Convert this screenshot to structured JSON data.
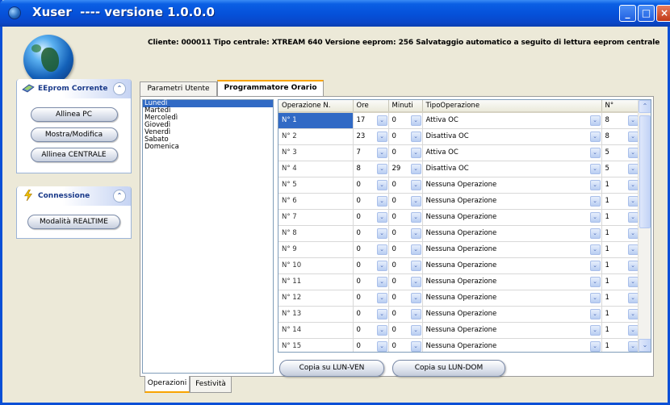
{
  "window": {
    "title": "Xuser  ---- versione 1.0.0.0",
    "controls": {
      "minimize": "_",
      "maximize": "□",
      "close": "×"
    }
  },
  "info_line": "Cliente: 000011 Tipo centrale: XTREAM 640 Versione eeprom: 256   Salvataggio automatico a seguito di lettura eeprom centrale",
  "sidebar": {
    "eeprom_panel": {
      "title": "EEprom Corrente",
      "icon": "eeprom-icon",
      "buttons": [
        "Allinea PC",
        "Mostra/Modifica",
        "Allinea CENTRALE"
      ]
    },
    "connection_panel": {
      "title": "Connessione",
      "icon": "lightning-icon",
      "buttons": [
        "Modalità REALTIME"
      ]
    }
  },
  "tabs_top": [
    "Parametri Utente",
    "Programmatore Orario"
  ],
  "active_top_tab": "Programmatore Orario",
  "days": [
    "Lunedì",
    "Martedì",
    "Mercoledì",
    "Giovedì",
    "Venerdì",
    "Sabato",
    "Domenica"
  ],
  "selected_day": "Lunedì",
  "grid": {
    "headers": [
      "Operazione N.",
      "Ore",
      "Minuti",
      "TipoOperazione",
      "N°"
    ],
    "rows": [
      {
        "op": "N° 1",
        "ore": "17",
        "min": "0",
        "tipo": "Attiva OC",
        "n": "8"
      },
      {
        "op": "N° 2",
        "ore": "23",
        "min": "0",
        "tipo": "Disattiva OC",
        "n": "8"
      },
      {
        "op": "N° 3",
        "ore": "7",
        "min": "0",
        "tipo": "Attiva OC",
        "n": "5"
      },
      {
        "op": "N° 4",
        "ore": "8",
        "min": "29",
        "tipo": "Disattiva OC",
        "n": "5"
      },
      {
        "op": "N° 5",
        "ore": "0",
        "min": "0",
        "tipo": "Nessuna Operazione",
        "n": "1"
      },
      {
        "op": "N° 6",
        "ore": "0",
        "min": "0",
        "tipo": "Nessuna Operazione",
        "n": "1"
      },
      {
        "op": "N° 7",
        "ore": "0",
        "min": "0",
        "tipo": "Nessuna Operazione",
        "n": "1"
      },
      {
        "op": "N° 8",
        "ore": "0",
        "min": "0",
        "tipo": "Nessuna Operazione",
        "n": "1"
      },
      {
        "op": "N° 9",
        "ore": "0",
        "min": "0",
        "tipo": "Nessuna Operazione",
        "n": "1"
      },
      {
        "op": "N° 10",
        "ore": "0",
        "min": "0",
        "tipo": "Nessuna Operazione",
        "n": "1"
      },
      {
        "op": "N° 11",
        "ore": "0",
        "min": "0",
        "tipo": "Nessuna Operazione",
        "n": "1"
      },
      {
        "op": "N° 12",
        "ore": "0",
        "min": "0",
        "tipo": "Nessuna Operazione",
        "n": "1"
      },
      {
        "op": "N° 13",
        "ore": "0",
        "min": "0",
        "tipo": "Nessuna Operazione",
        "n": "1"
      },
      {
        "op": "N° 14",
        "ore": "0",
        "min": "0",
        "tipo": "Nessuna Operazione",
        "n": "1"
      },
      {
        "op": "N° 15",
        "ore": "0",
        "min": "0",
        "tipo": "Nessuna Operazione",
        "n": "1"
      }
    ]
  },
  "copy_buttons": [
    "Copia su LUN-VEN",
    "Copia su LUN-DOM"
  ],
  "tabs_bottom": [
    "Operazioni",
    "Festività"
  ],
  "active_bottom_tab": "Operazioni",
  "colors": {
    "titlebar": "#0550d9",
    "selection": "#316ac5",
    "tab_accent": "#f8a400"
  }
}
